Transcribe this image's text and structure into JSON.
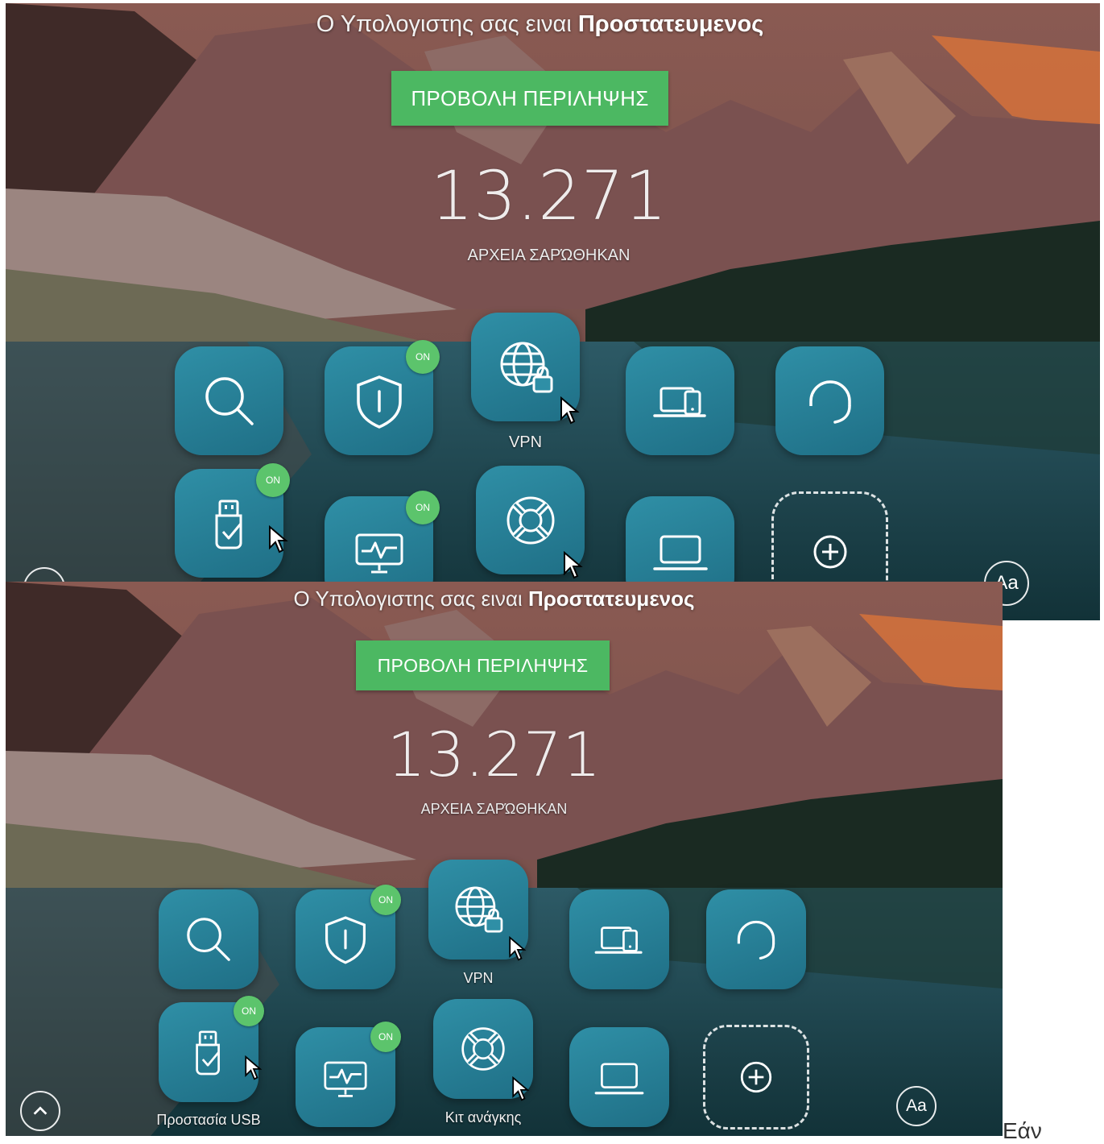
{
  "status": {
    "prefix": "Ο Υπολογιστης σας ειναι ",
    "emphasis": "Προστατευμενος"
  },
  "summary_button": "ΠΡΟΒΟΛΗ ΠΕΡΙΛΗΨΗΣ",
  "scan": {
    "count": "13.271",
    "label": "ΑΡΧΕΙΑ ΣΑΡΏΘΗΚΑΝ"
  },
  "badge_on": "ON",
  "tiles": {
    "vpn_label": "VPN",
    "usb_label": "Προστασία USB",
    "rescue_label": "Κιτ ανάγκης"
  },
  "font_button": "Aa",
  "trailing_text": "Εάν",
  "colors": {
    "accent_green": "#4cb862",
    "tile_teal": "#2f8fa6",
    "badge_green": "#5cc46c"
  }
}
